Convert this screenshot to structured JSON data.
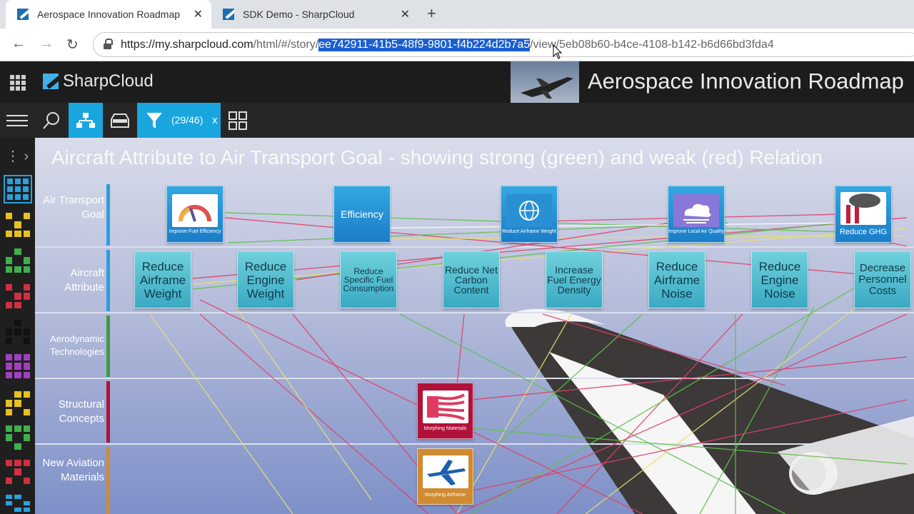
{
  "browser": {
    "tabs": [
      {
        "title": "Aerospace Innovation Roadmap",
        "active": true
      },
      {
        "title": "SDK Demo - SharpCloud",
        "active": false
      }
    ],
    "url": {
      "prefix": "https://my.sharpcloud.com",
      "path_before": "/html/#/story/",
      "selected": "ee742911-41b5-48f9-9801-f4b224d2b7a5",
      "path_after": "/view/5eb08b60-b4ce-4108-b142-b6d66bd3fda4"
    }
  },
  "app": {
    "brand": "SharpCloud",
    "story_title": "Aerospace Innovation Roadmap",
    "filter_count": "(29/46)",
    "filter_clear": "x"
  },
  "view": {
    "title": "Aircraft Attribute to Air Transport Goal - showing strong (green) and weak (red) Relation"
  },
  "lanes": [
    {
      "label": "Air Transport Goal",
      "color": "#2aa0dc"
    },
    {
      "label": "Aircraft Attribute",
      "color": "#2aa0dc"
    },
    {
      "label": "Aerodynamic Technologies",
      "color": "#3f9a3f"
    },
    {
      "label": "Structural Concepts",
      "color": "#b0123a"
    },
    {
      "label": "New Aviation Materials",
      "color": "#d08a30"
    }
  ],
  "goals": [
    {
      "label": "Improve Fuel Efficiency",
      "icon": "gauge-icon"
    },
    {
      "label": "Efficiency",
      "icon": ""
    },
    {
      "label": "Reduce Airframe Weight",
      "icon": "globe-icon"
    },
    {
      "label": "Improve Local Air Quality",
      "icon": "cloud-icon"
    },
    {
      "label": "Reduce GHG",
      "icon": "factory-icon"
    }
  ],
  "attributes": [
    "Reduce Airframe Weight",
    "Reduce Engine Weight",
    "Reduce Specific Fuel Consumption",
    "Reduce Net Carbon Content",
    "Increase Fuel Energy Density",
    "Reduce Airframe Noise",
    "Reduce Engine Noise",
    "Decrease Personnel Costs"
  ],
  "technologies": [
    {
      "label": "Morphing Materials",
      "lane": "Structural Concepts",
      "color": "#b0123a"
    },
    {
      "label": "Morphing Airframe",
      "lane": "New Aviation Materials",
      "color": "#d08a30"
    }
  ],
  "colors": {
    "strong": "#5fbf4a",
    "weak": "#e0406a",
    "neutral": "#e8e070"
  }
}
